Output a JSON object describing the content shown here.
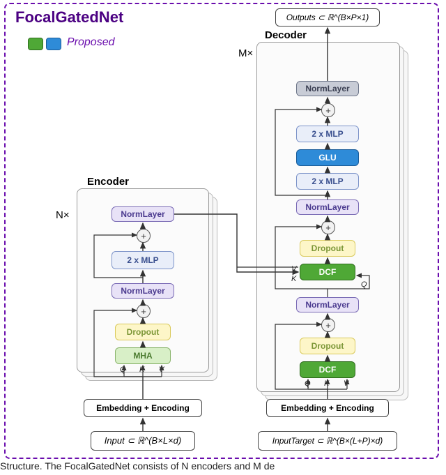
{
  "title": "FocalGatedNet",
  "legend": {
    "proposed": "Proposed"
  },
  "encoder": {
    "title": "Encoder",
    "times": "N×",
    "input": "Input ⊂ ℝ^(B×L×d)",
    "embed": "Embedding + Encoding",
    "mha": "MHA",
    "dropout": "Dropout",
    "norm1": "NormLayer",
    "mlp": "2 x MLP",
    "norm2": "NormLayer",
    "q": "Q",
    "k": "K",
    "v": "V"
  },
  "decoder": {
    "title": "Decoder",
    "times": "M×",
    "input": "InputTarget ⊂ ℝ^(B×(L+P)×d)",
    "output": "Outputs ⊂ ℝ^(B×P×1)",
    "embed": "Embedding + Encoding",
    "dcf1": "DCF",
    "dropout1": "Dropout",
    "norm1": "NormLayer",
    "dcf2": "DCF",
    "dropout2": "Dropout",
    "norm2": "NormLayer",
    "mlp1": "2 x MLP",
    "glu": "GLU",
    "mlp2": "2 x MLP",
    "norm3": "NormLayer",
    "q": "Q",
    "k": "K",
    "v": "V",
    "q2": "Q",
    "k2": "K",
    "v2": "V"
  },
  "caption": "Structure. The FocalGatedNet consists of N encoders and M de"
}
